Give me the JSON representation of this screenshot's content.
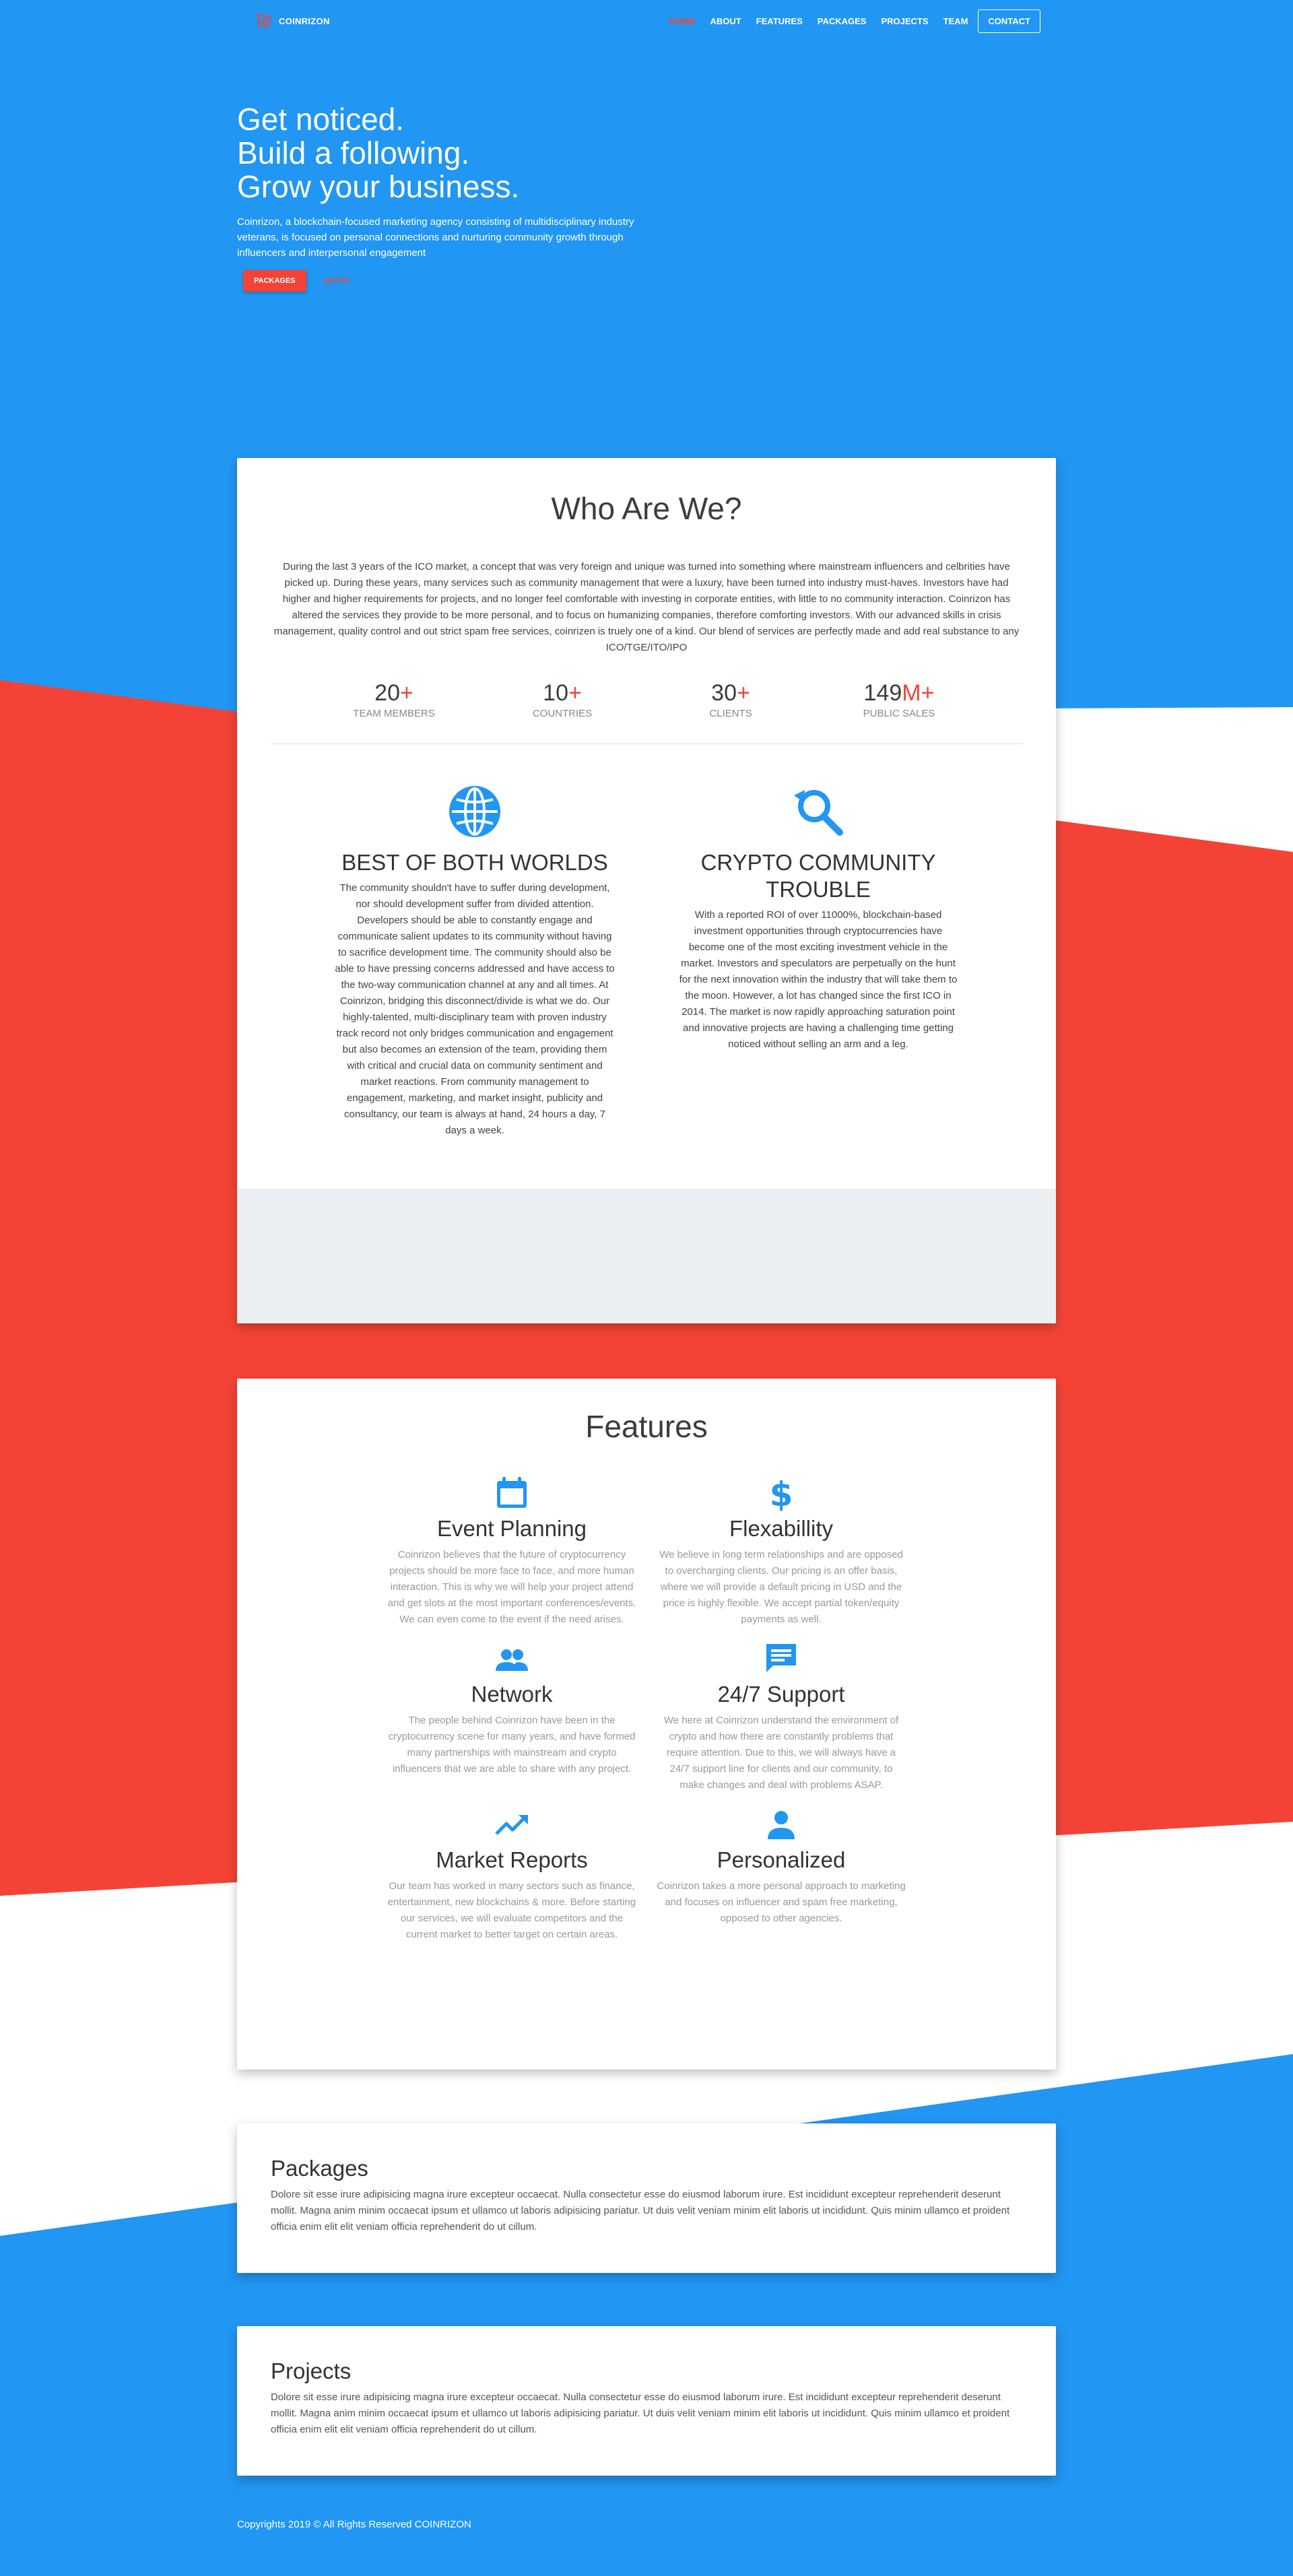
{
  "brand": {
    "name": "COINRIZON"
  },
  "nav": {
    "items": [
      "HOME",
      "ABOUT",
      "FEATURES",
      "PACKAGES",
      "PROJECTS",
      "TEAM"
    ],
    "contact": "CONTACT"
  },
  "hero": {
    "line1": "Get noticed.",
    "line2": "Build a following.",
    "line3": "Grow your business.",
    "description": "Coinrizon, a blockchain-focused marketing agency consisting of multidisciplinary industry veterans, is focused on personal connections and nurturing community growth through influencers and interpersonal engagement",
    "primary_button": "PACKAGES",
    "secondary_button": "QUOTE"
  },
  "who": {
    "title": "Who Are We?",
    "text": "During the last 3 years of the ICO market, a concept that was very foreign and unique was turned into something where mainstream influencers and celbrities have picked up. During these years, many services such as community management that were a luxury, have been turned into industry must-haves. Investors have had higher and higher requirements for projects, and no longer feel comfortable with investing in corporate entities, with little to no community interaction. Coinrizon has altered the services they provide to be more personal, and to focus on humanizing companies, therefore comforting investors. With our advanced skills in crisis management, quality control and out strict spam free services, coinrizen is truely one of a kind. Our blend of services are perfectly made and add real substance to any ICO/TGE/ITO/IPO",
    "stats": [
      {
        "value": "20",
        "suffix": "+",
        "label": "TEAM MEMBERS"
      },
      {
        "value": "10",
        "suffix": "+",
        "label": "COUNTRIES"
      },
      {
        "value": "30",
        "suffix": "+",
        "label": "CLIENTS"
      },
      {
        "value": "149",
        "suffix": "M+",
        "label": "PUBLIC SALES"
      }
    ],
    "left": {
      "icon": "globe-icon",
      "title": "BEST OF BOTH WORLDS",
      "text": "The community shouldn't have to suffer during development, nor should development suffer from divided attention. Developers should be able to constantly engage and communicate salient updates to its community without having to sacrifice development time. The community should also be able to have pressing concerns addressed and have access to the two-way communication channel at any and all times. At Coinrizon, bridging this disconnect/divide is what we do. Our highly-talented, multi-disciplinary team with proven industry track record not only bridges communication and engagement but also becomes an extension of the team, providing them with critical and crucial data on community sentiment and market reactions. From community management to engagement, marketing, and market insight, publicity and consultancy, our team is always at hand, 24 hours a day, 7 days a week."
    },
    "right": {
      "icon": "search-refresh-icon",
      "title": "CRYPTO COMMUNITY TROUBLE",
      "text": "With a reported ROI of over 11000%, blockchain-based investment opportunities through cryptocurrencies have become one of the most exciting investment vehicle in the market. Investors and speculators are perpetually on the hunt for the next innovation within the industry that will take them to the moon. However, a lot has changed since the first ICO in 2014. The market is now rapidly approaching saturation point and innovative projects are having a challenging time getting noticed without selling an arm and a leg."
    }
  },
  "features": {
    "title": "Features",
    "items": [
      {
        "icon": "calendar-icon",
        "title": "Event Planning",
        "text": "Coinrizon believes that the future of cryptocurrency projects should be more face to face, and more human interaction. This is why we will help your project attend and get slots at the most important conferences/events. We can even come to the event if the need arises."
      },
      {
        "icon": "dollar-icon",
        "title": "Flexabillity",
        "text": "We believe in long term relationships and are opposed to overcharging clients. Our pricing is an offer basis, where we will provide a default pricing in USD and the price is highly flexible. We accept partial token/equity payments as well."
      },
      {
        "icon": "people-icon",
        "title": "Network",
        "text": "The people behind Coinrizon have been in the cryptocurrency scene for many years, and have formed many partnerships with mainstream and crypto influencers that we are able to share with any project."
      },
      {
        "icon": "chat-icon",
        "title": "24/7 Support",
        "text": "We here at Coinrizon understand the environment of crypto and how there are constantly problems that require attention. Due to this, we will always have a 24/7 support line for clients and our community, to make changes and deal with problems ASAP."
      },
      {
        "icon": "trending-icon",
        "title": "Market Reports",
        "text": "Our team has worked in many sectors such as finance, entertainment, new blockchains & more. Before starting our services, we will evaluate competitors and the current market to better target on certain areas."
      },
      {
        "icon": "person-icon",
        "title": "Personalized",
        "text": "Coinrizon takes a more personal approach to marketing and focuses on influencer and spam free marketing, opposed to other agencies."
      }
    ]
  },
  "packages": {
    "title": "Packages",
    "text": "Dolore sit esse irure adipisicing magna irure excepteur occaecat. Nulla consectetur esse do eiusmod laborum irure. Est incididunt excepteur reprehenderit deserunt mollit. Magna anim minim occaecat ipsum et ullamco ut laboris adipisicing pariatur. Ut duis velit veniam minim elit laboris ut incididunt. Quis minim ullamco et proident officia enim elit elit veniam officia reprehenderit do ut cillum."
  },
  "projects": {
    "title": "Projects",
    "text": "Dolore sit esse irure adipisicing magna irure excepteur occaecat. Nulla consectetur esse do eiusmod laborum irure. Est incididunt excepteur reprehenderit deserunt mollit. Magna anim minim occaecat ipsum et ullamco ut laboris adipisicing pariatur. Ut duis velit veniam minim elit laboris ut incididunt. Quis minim ullamco et proident officia enim elit elit veniam officia reprehenderit do ut cillum."
  },
  "footer": {
    "text": "Copyrights 2019 © All Rights Reserved COINRIZON"
  },
  "colors": {
    "blue": "#2196f3",
    "red": "#f44336",
    "white": "#ffffff",
    "grey": "#eceff1"
  }
}
